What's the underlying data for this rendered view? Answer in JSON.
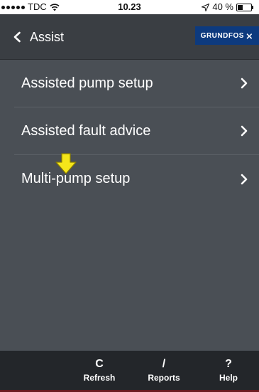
{
  "status_bar": {
    "carrier": "TDC",
    "time": "10.23",
    "battery_text": "40 %",
    "battery_level": 0.4,
    "signal_bars": 5,
    "wifi_icon": "wifi-icon",
    "location_icon": "location-arrow-icon"
  },
  "nav": {
    "title": "Assist",
    "back_icon": "chevron-left-icon",
    "brand": {
      "text": "GRUNDFOS",
      "mark": "⨯",
      "color": "#0d3a7e"
    }
  },
  "menu": {
    "items": [
      {
        "label": "Assisted pump setup"
      },
      {
        "label": "Assisted fault advice"
      },
      {
        "label": "Multi-pump setup"
      }
    ],
    "chevron_icon": "chevron-right-icon"
  },
  "annotation": {
    "arrow_icon": "down-arrow-icon",
    "color": "#f5e61a"
  },
  "toolbar": {
    "refresh": {
      "label": "Refresh",
      "icon": "refresh-icon",
      "glyph": "C"
    },
    "reports": {
      "label": "Reports",
      "icon": "pencil-icon",
      "glyph": "/"
    },
    "help": {
      "label": "Help",
      "icon": "help-icon",
      "glyph": "?"
    }
  },
  "colors": {
    "background": "#4a4f55",
    "nav_bar": "#3a3e43",
    "toolbar": "#23262a",
    "accent_strip": "#6b1d22"
  }
}
